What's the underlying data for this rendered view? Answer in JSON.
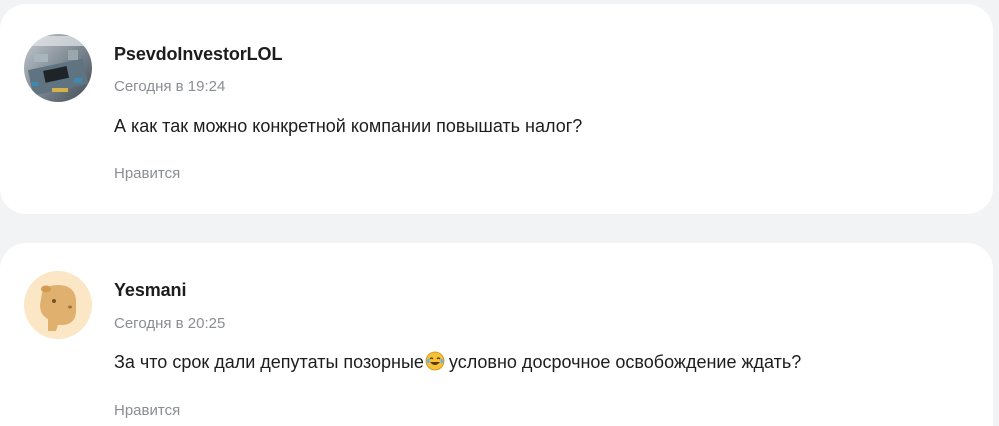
{
  "comments": [
    {
      "author": "PsevdoInvestorLOL",
      "time": "Сегодня в 19:24",
      "text": "А как так можно конкретной компании повышать налог?",
      "like_label": "Нравится",
      "avatar_icon": "circuit-board-photo-avatar"
    },
    {
      "author": "Yesmani",
      "time": "Сегодня в 20:25",
      "text_before_emoji": "За что срок дали депутаты позорные",
      "emoji_icon": "laughing-tears-emoji",
      "text_after_emoji": "условно досрочное освобождение ждать?",
      "like_label": "Нравится",
      "avatar_icon": "capybara-avatar"
    }
  ],
  "colors": {
    "background": "#f2f3f5",
    "card": "#ffffff",
    "text": "#1d1d1f",
    "muted": "#8a8d93",
    "capybara_bg": "#fbe6c6",
    "capybara": "#e0b06f"
  }
}
